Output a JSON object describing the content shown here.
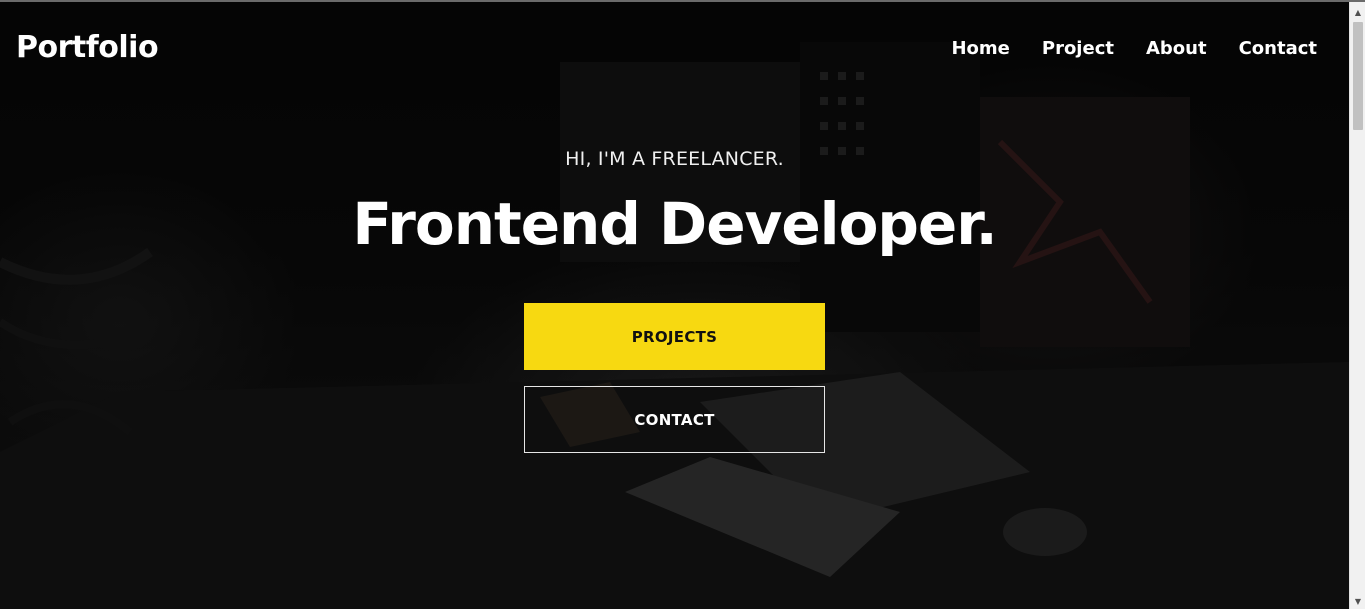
{
  "navbar": {
    "logo": "Portfolio",
    "links": [
      "Home",
      "Project",
      "About",
      "Contact"
    ]
  },
  "hero": {
    "subtitle": "HI, I'M A FREELANCER.",
    "headline": "Frontend Developer.",
    "primary_button": "PROJECTS",
    "secondary_button": "CONTACT"
  },
  "colors": {
    "accent": "#f7d911",
    "background": "#000000",
    "text": "#ffffff"
  },
  "icons": {
    "scroll_up": "triangle-up-icon",
    "scroll_down": "triangle-down-icon"
  }
}
